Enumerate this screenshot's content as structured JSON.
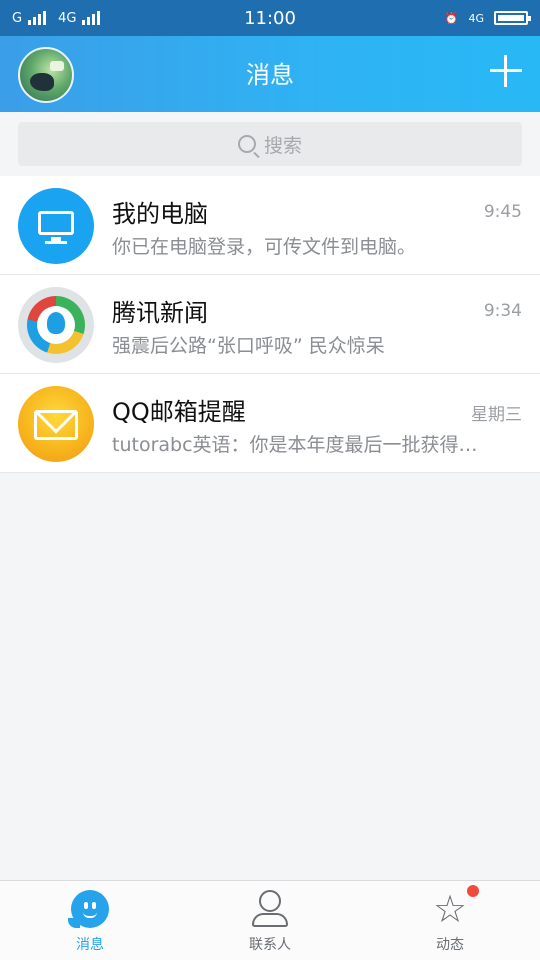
{
  "statusbar": {
    "carrier1": "G",
    "carrier2": "4G",
    "time": "11:00",
    "net": "4G"
  },
  "header": {
    "title": "消息"
  },
  "search": {
    "placeholder": "搜索"
  },
  "conversations": [
    {
      "title": "我的电脑",
      "time": "9:45",
      "message": "你已在电脑登录，可传文件到电脑。",
      "icon": "computer-icon"
    },
    {
      "title": "腾讯新闻",
      "time": "9:34",
      "message": "强震后公路“张口呼吸” 民众惊呆",
      "icon": "tencent-news-icon"
    },
    {
      "title": "QQ邮箱提醒",
      "time": "星期三",
      "message": "tutorabc英语：你是本年度最后一批获得…",
      "icon": "mail-icon"
    }
  ],
  "tabs": [
    {
      "label": "消息",
      "icon": "chat-icon",
      "active": true
    },
    {
      "label": "联系人",
      "icon": "contacts-icon",
      "active": false
    },
    {
      "label": "动态",
      "icon": "star-icon",
      "active": false,
      "badge": true
    }
  ],
  "colors": {
    "accent": "#27a3ec",
    "header_start": "#3a9ee8",
    "header_end": "#28b8f6",
    "badge": "#f04b3f"
  }
}
